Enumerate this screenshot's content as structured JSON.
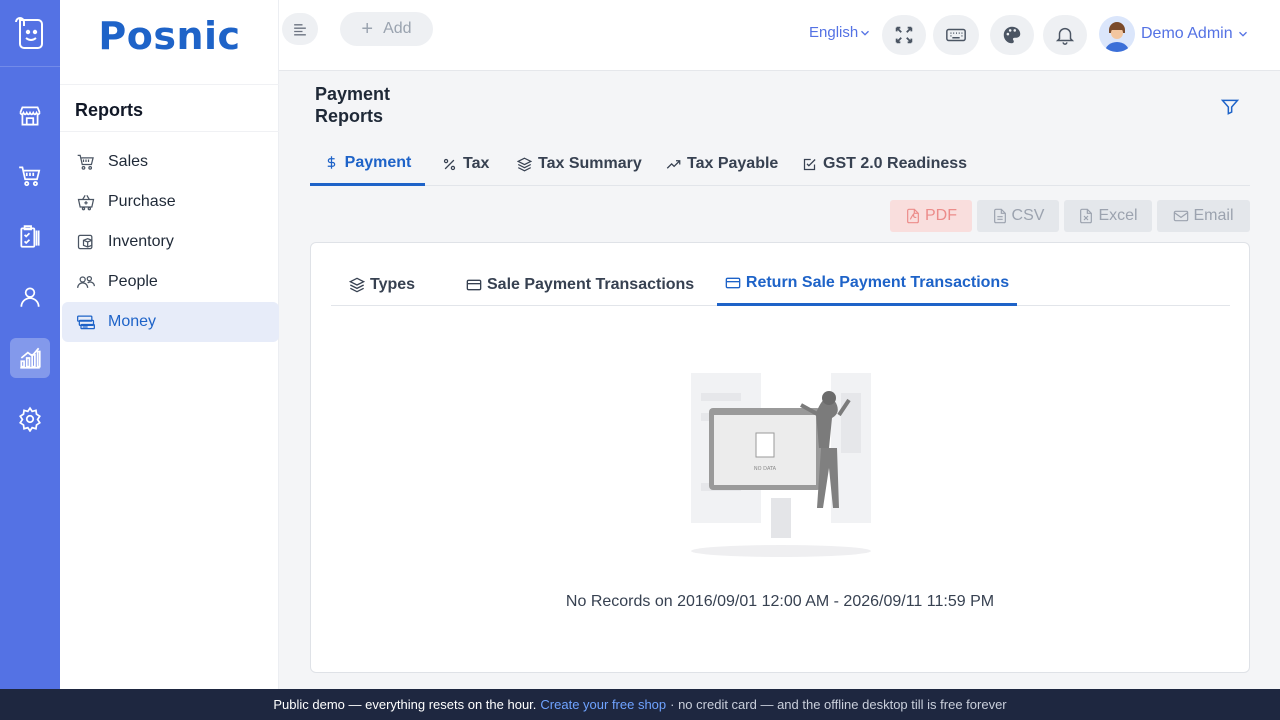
{
  "brand": {
    "name": "Posnic"
  },
  "sidebar": {
    "title": "Reports",
    "items": [
      {
        "label": "Sales",
        "icon": "cart-icon"
      },
      {
        "label": "Purchase",
        "icon": "basket-icon"
      },
      {
        "label": "Inventory",
        "icon": "box-icon"
      },
      {
        "label": "People",
        "icon": "people-icon"
      },
      {
        "label": "Money",
        "icon": "money-icon",
        "active": true
      }
    ]
  },
  "topbar": {
    "add_label": "Add",
    "language": "English",
    "user_name": "Demo Admin"
  },
  "page": {
    "title": "Payment Reports"
  },
  "tabs": [
    {
      "label": "Payment",
      "icon": "dollar-icon",
      "active": true
    },
    {
      "label": "Tax",
      "icon": "percent-icon"
    },
    {
      "label": "Tax Summary",
      "icon": "layers-icon"
    },
    {
      "label": "Tax Payable",
      "icon": "trend-icon"
    },
    {
      "label": "GST 2.0 Readiness",
      "icon": "checkbox-icon"
    }
  ],
  "exports": {
    "pdf": "PDF",
    "csv": "CSV",
    "excel": "Excel",
    "email": "Email"
  },
  "subtabs": [
    {
      "label": "Types",
      "icon": "layers-icon"
    },
    {
      "label": "Sale Payment Transactions",
      "icon": "card-icon"
    },
    {
      "label": "Return Sale Payment Transactions",
      "icon": "card-icon",
      "active": true
    }
  ],
  "empty": {
    "illustration_text": "NO DATA",
    "message": "No Records on 2016/09/01 12:00 AM - 2026/09/11 11:59 PM"
  },
  "banner": {
    "lead": "Public demo — everything resets on the hour.",
    "link": "Create your free shop",
    "tail": "· no credit card — and the offline desktop till is free forever"
  },
  "colors": {
    "rail": "#5472e4",
    "accent": "#1e63c8",
    "banner": "#1e2740"
  }
}
